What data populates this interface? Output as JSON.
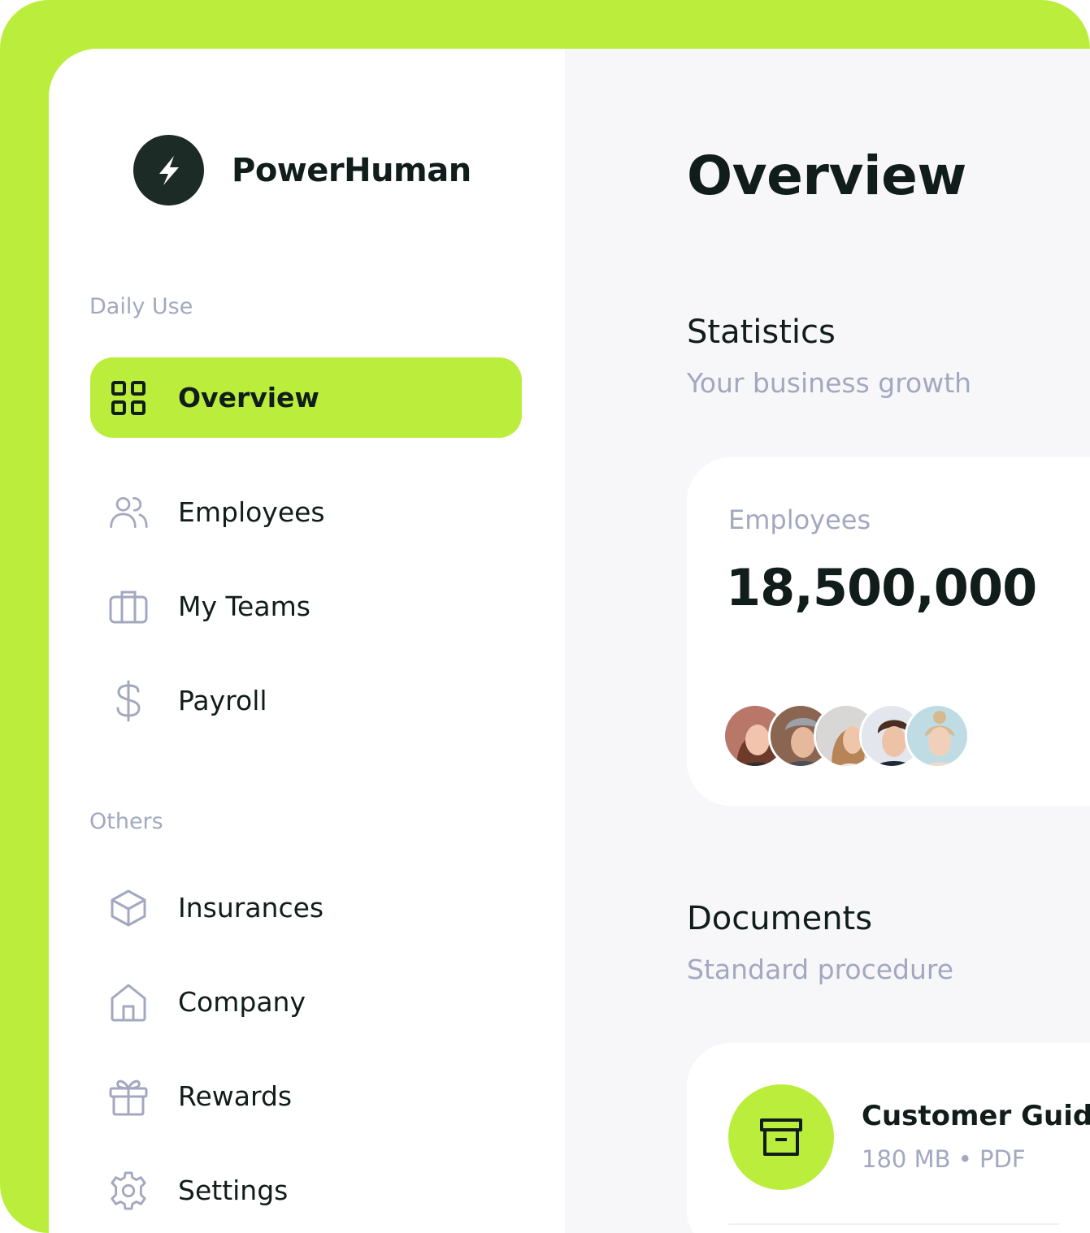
{
  "colors": {
    "accent": "#BBEE3C",
    "dark": "#111D1A",
    "muted": "#A3A8C0",
    "surface": "#F7F7F9"
  },
  "brand": {
    "name": "PowerHuman",
    "logo_icon": "bolt-icon"
  },
  "sidebar": {
    "daily_label": "Daily Use",
    "others_label": "Others",
    "daily_items": [
      {
        "label": "Overview",
        "icon": "grid-icon",
        "active": true
      },
      {
        "label": "Employees",
        "icon": "users-icon"
      },
      {
        "label": "My Teams",
        "icon": "briefcase-icon"
      },
      {
        "label": "Payroll",
        "icon": "dollar-icon"
      }
    ],
    "other_items": [
      {
        "label": "Insurances",
        "icon": "box-icon"
      },
      {
        "label": "Company",
        "icon": "home-icon"
      },
      {
        "label": "Rewards",
        "icon": "gift-icon"
      },
      {
        "label": "Settings",
        "icon": "gear-icon"
      }
    ]
  },
  "main": {
    "title": "Overview",
    "statistics": {
      "title": "Statistics",
      "subtitle": "Your business growth",
      "card": {
        "label": "Employees",
        "value": "18,500,000",
        "avatar_count": 5
      }
    },
    "documents": {
      "title": "Documents",
      "subtitle": "Standard procedure",
      "items": [
        {
          "name": "Customer Guide",
          "meta": "180 MB • PDF",
          "icon": "archive-icon"
        }
      ]
    }
  }
}
